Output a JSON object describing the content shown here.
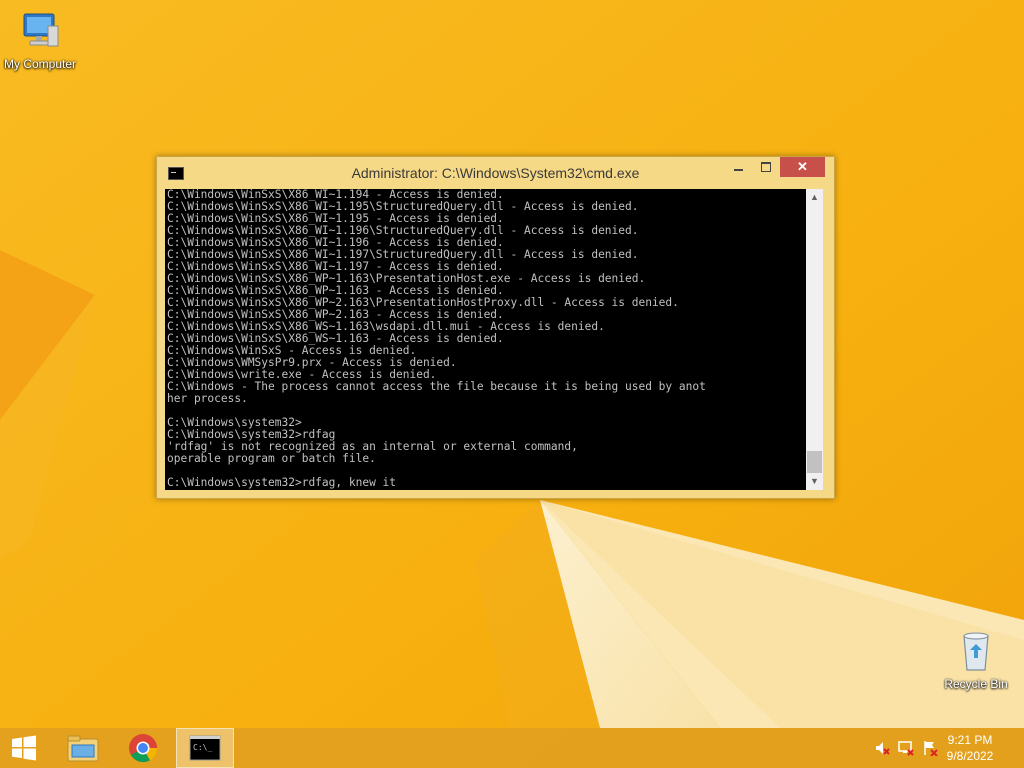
{
  "desktop": {
    "icons": [
      {
        "label": "My Computer",
        "icon": "computer-icon"
      },
      {
        "label": "Recycle Bin",
        "icon": "recycle-bin-icon"
      }
    ]
  },
  "window": {
    "title": "Administrator: C:\\Windows\\System32\\cmd.exe",
    "close_glyph": "✕",
    "console_lines": [
      "C:\\Windows\\WinSxS\\X86_WI~1.194 - Access is denied.",
      "C:\\Windows\\WinSxS\\X86_WI~1.195\\StructuredQuery.dll - Access is denied.",
      "C:\\Windows\\WinSxS\\X86_WI~1.195 - Access is denied.",
      "C:\\Windows\\WinSxS\\X86_WI~1.196\\StructuredQuery.dll - Access is denied.",
      "C:\\Windows\\WinSxS\\X86_WI~1.196 - Access is denied.",
      "C:\\Windows\\WinSxS\\X86_WI~1.197\\StructuredQuery.dll - Access is denied.",
      "C:\\Windows\\WinSxS\\X86_WI~1.197 - Access is denied.",
      "C:\\Windows\\WinSxS\\X86_WP~1.163\\PresentationHost.exe - Access is denied.",
      "C:\\Windows\\WinSxS\\X86_WP~1.163 - Access is denied.",
      "C:\\Windows\\WinSxS\\X86_WP~2.163\\PresentationHostProxy.dll - Access is denied.",
      "C:\\Windows\\WinSxS\\X86_WP~2.163 - Access is denied.",
      "C:\\Windows\\WinSxS\\X86_WS~1.163\\wsdapi.dll.mui - Access is denied.",
      "C:\\Windows\\WinSxS\\X86_WS~1.163 - Access is denied.",
      "C:\\Windows\\WinSxS - Access is denied.",
      "C:\\Windows\\WMSysPr9.prx - Access is denied.",
      "C:\\Windows\\write.exe - Access is denied.",
      "C:\\Windows - The process cannot access the file because it is being used by anot",
      "her process.",
      "",
      "C:\\Windows\\system32>",
      "C:\\Windows\\system32>rdfag",
      "'rdfag' is not recognized as an internal or external command,",
      "operable program or batch file.",
      "",
      "C:\\Windows\\system32>rdfag, knew it"
    ]
  },
  "taskbar": {
    "items": [
      {
        "name": "start",
        "icon": "windows-logo-icon"
      },
      {
        "name": "file-explorer",
        "icon": "folder-icon"
      },
      {
        "name": "chrome",
        "icon": "chrome-icon"
      },
      {
        "name": "command-prompt",
        "icon": "cmd-icon"
      }
    ],
    "tray": {
      "icons": [
        "volume-muted-icon",
        "network-icon",
        "action-center-icon"
      ],
      "time": "9:21 PM",
      "date": "9/8/2022"
    }
  }
}
